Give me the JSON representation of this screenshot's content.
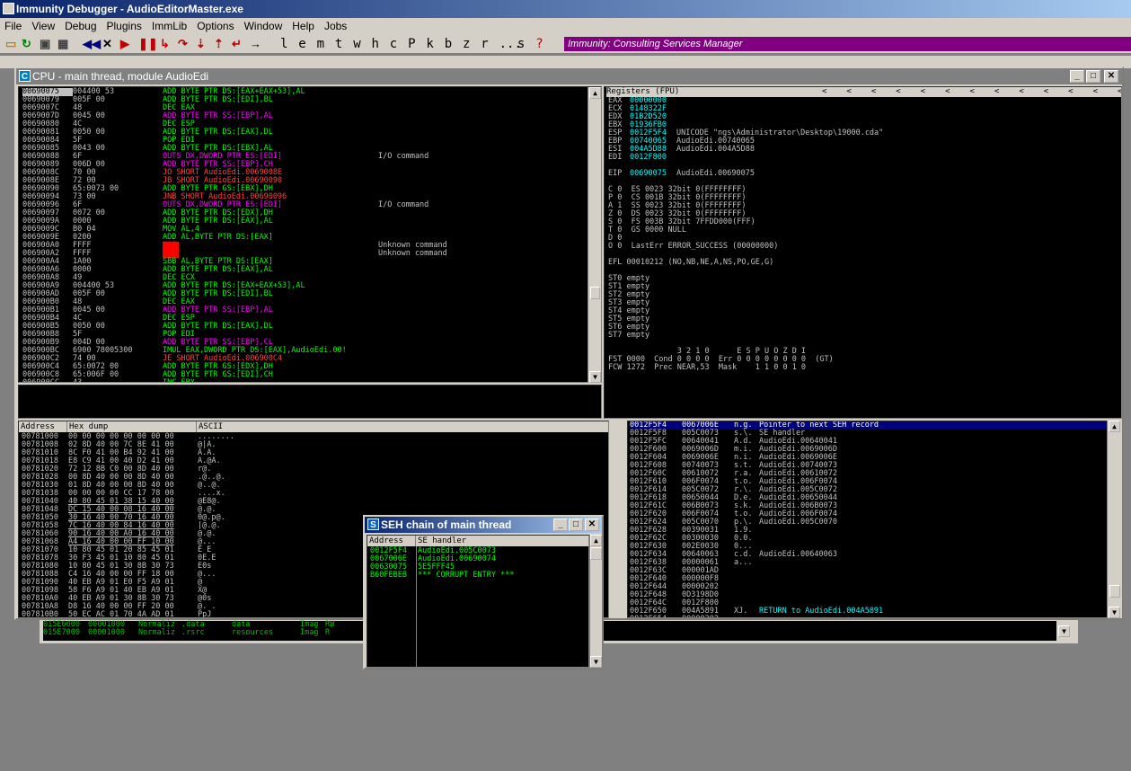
{
  "app": {
    "title": "Immunity Debugger - AudioEditorMaster.exe",
    "banner": "Immunity: Consulting Services Manager"
  },
  "menu": [
    "File",
    "View",
    "Debug",
    "Plugins",
    "ImmLib",
    "Options",
    "Window",
    "Help",
    "Jobs"
  ],
  "toolbar_letters": [
    "l",
    "e",
    "m",
    "t",
    "w",
    "h",
    "c",
    "P",
    "k",
    "b",
    "z",
    "r",
    "...",
    "s",
    "?"
  ],
  "cpu": {
    "title": "CPU - main thread, module AudioEdi",
    "disasm": [
      [
        "00690075",
        "004400 53",
        "ADD BYTE PTR DS:[EAX+EAX+53],AL",
        "",
        "sel"
      ],
      [
        "00690079",
        "005F 00",
        "ADD BYTE PTR DS:[EDI],BL",
        "",
        "c"
      ],
      [
        "0069007C",
        "48",
        "DEC EAX",
        "",
        "c"
      ],
      [
        "0069007D",
        "0045 00",
        "ADD BYTE PTR SS:[EBP],AL",
        "",
        "m"
      ],
      [
        "00690080",
        "4C",
        "DEC ESP",
        "",
        "c"
      ],
      [
        "00690081",
        "0050 00",
        "ADD BYTE PTR DS:[EAX],DL",
        "",
        "c"
      ],
      [
        "00690084",
        "5F",
        "POP EDI",
        "",
        "c"
      ],
      [
        "00690085",
        "0043 00",
        "ADD BYTE PTR DS:[EBX],AL",
        "",
        "c"
      ],
      [
        "00690088",
        "6F",
        "OUTS DX,DWORD PTR ES:[EDI]",
        "I/O command",
        "m"
      ],
      [
        "00690089",
        "006D 00",
        "ADD BYTE PTR SS:[EBP],CH",
        "",
        "m"
      ],
      [
        "0069008C",
        "70 00",
        "JO SHORT AudioEdi.0069008E",
        "",
        "j"
      ],
      [
        "0069008E",
        "72 00",
        "JB SHORT AudioEdi.00690090",
        "",
        "j"
      ],
      [
        "00690090",
        "65:0073 00",
        "ADD BYTE PTR GS:[EBX],DH",
        "",
        "c"
      ],
      [
        "00690094",
        "73 00",
        "JNB SHORT AudioEdi.00690096",
        "",
        "j"
      ],
      [
        "00690096",
        "6F",
        "OUTS DX,DWORD PTR ES:[EDI]",
        "I/O command",
        "m"
      ],
      [
        "00690097",
        "0072 00",
        "ADD BYTE PTR DS:[EDX],DH",
        "",
        "c"
      ],
      [
        "0069009A",
        "0000",
        "ADD BYTE PTR DS:[EAX],AL",
        "",
        "c"
      ],
      [
        "0069009C",
        "B0 04",
        "MOV AL,4",
        "",
        "c"
      ],
      [
        "0069009E",
        "0200",
        "ADD AL,BYTE PTR DS:[EAX]",
        "",
        "c"
      ],
      [
        "006900A0",
        "FFFF",
        "???",
        "Unknown command",
        "r"
      ],
      [
        "006900A2",
        "FFFF",
        "???",
        "Unknown command",
        "r"
      ],
      [
        "006900A4",
        "1A00",
        "SBB AL,BYTE PTR DS:[EAX]",
        "",
        "c"
      ],
      [
        "006900A6",
        "0000",
        "ADD BYTE PTR DS:[EAX],AL",
        "",
        "c"
      ],
      [
        "006900A8",
        "49",
        "DEC ECX",
        "",
        "c"
      ],
      [
        "006900A9",
        "004400 53",
        "ADD BYTE PTR DS:[EAX+EAX+53],AL",
        "",
        "c"
      ],
      [
        "006900AD",
        "005F 00",
        "ADD BYTE PTR DS:[EDI],BL",
        "",
        "c"
      ],
      [
        "006900B0",
        "48",
        "DEC EAX",
        "",
        "c"
      ],
      [
        "006900B1",
        "0045 00",
        "ADD BYTE PTR SS:[EBP],AL",
        "",
        "m"
      ],
      [
        "006900B4",
        "4C",
        "DEC ESP",
        "",
        "c"
      ],
      [
        "006900B5",
        "0050 00",
        "ADD BYTE PTR DS:[EAX],DL",
        "",
        "c"
      ],
      [
        "006900B8",
        "5F",
        "POP EDI",
        "",
        "c"
      ],
      [
        "006900B9",
        "004D 00",
        "ADD BYTE PTR SS:[EBP],CL",
        "",
        "m"
      ],
      [
        "006900BC",
        "6900 78005300",
        "IMUL EAX,DWORD PTR DS:[EAX],AudioEdi.00!",
        "",
        "c"
      ],
      [
        "006900C2",
        "74 00",
        "JE SHORT AudioEdi.006900C4",
        "",
        "j"
      ],
      [
        "006900C4",
        "65:0072 00",
        "ADD BYTE PTR GS:[EDX],DH",
        "",
        "c"
      ],
      [
        "006900C8",
        "65:006F 00",
        "ADD BYTE PTR GS:[EDI],CH",
        "",
        "c"
      ],
      [
        "006900CC",
        "43",
        "INC EBX",
        "",
        "c"
      ]
    ]
  },
  "registers": {
    "header": "Registers (FPU)",
    "lines": [
      [
        "EAX",
        "00000000",
        ""
      ],
      [
        "ECX",
        "0148322F",
        ""
      ],
      [
        "EDX",
        "01B2D520",
        ""
      ],
      [
        "EBX",
        "01936FB0",
        ""
      ],
      [
        "ESP",
        "0012F5F4",
        "UNICODE \"ngs\\Administrator\\Desktop\\19000.cda\""
      ],
      [
        "EBP",
        "00740065",
        "AudioEdi.00740065"
      ],
      [
        "ESI",
        "004A5D88",
        "AudioEdi.004A5D88"
      ],
      [
        "EDI",
        "0012F800",
        ""
      ],
      [
        "",
        "",
        " "
      ],
      [
        "EIP",
        "00690075",
        "AudioEdi.00690075"
      ]
    ],
    "flags": [
      "C 0  ES 0023 32bit 0(FFFFFFFF)",
      "P 0  CS 001B 32bit 0(FFFFFFFF)",
      "A 1  SS 0023 32bit 0(FFFFFFFF)",
      "Z 0  DS 0023 32bit 0(FFFFFFFF)",
      "S 0  FS 003B 32bit 7FFDD000(FFF)",
      "T 0  GS 0000 NULL",
      "D 0",
      "O 0  LastErr ERROR_SUCCESS (00000000)"
    ],
    "efl": "EFL 00010212 (NO,NB,NE,A,NS,PO,GE,G)",
    "st": [
      "ST0 empty",
      "ST1 empty",
      "ST2 empty",
      "ST3 empty",
      "ST4 empty",
      "ST5 empty",
      "ST6 empty",
      "ST7 empty"
    ],
    "fpu": [
      "               3 2 1 0      E S P U O Z D I",
      "FST 0000  Cond 0 0 0 0  Err 0 0 0 0 0 0 0 0  (GT)",
      "FCW 1272  Prec NEAR,53  Mask    1 1 0 0 1 0"
    ]
  },
  "dump": {
    "headers": [
      "Address",
      "Hex dump",
      "ASCII"
    ],
    "rows": [
      [
        "00781000",
        "00 00 00 00 00 00 00 00",
        "........"
      ],
      [
        "00781008",
        "02 8D 40 00 7C 8E 41 00",
        "@|A."
      ],
      [
        "00781010",
        "8C F0 41 00 B4 92 41 00",
        "A.A."
      ],
      [
        "00781018",
        "E8 C9 41 00 40 D2 41 00",
        "A.@A."
      ],
      [
        "00781020",
        "72 12 8B C0 00 8D 40 00",
        "r@."
      ],
      [
        "00781028",
        "00 8D 40 00 00 8D 40 00",
        ".@..@."
      ],
      [
        "00781030",
        "01 8D 40 00 00 8D 40 00",
        "@..@."
      ],
      [
        "00781038",
        "00 00 00 00 CC 17 78 00",
        "....x."
      ],
      [
        "00781040",
        "40 80 45 01 38 15 40 00",
        "@E8@."
      ],
      [
        "00781048",
        "DC 15 40 00 08 16 40 00",
        "@.@."
      ],
      [
        "00781050",
        "30 16 40 00 70 16 40 00",
        "0@.p@."
      ],
      [
        "00781058",
        "7C 16 40 00 84 16 40 00",
        "|@.@."
      ],
      [
        "00781060",
        "90 16 40 00 A0 16 40 00",
        "@.@."
      ],
      [
        "00781068",
        "A4 16 40 00 00 FF 10 00",
        "@..."
      ],
      [
        "00781070",
        "10 80 45 01 20 85 45 01",
        "E E"
      ],
      [
        "00781078",
        "30 F3 45 01 10 80 45 01",
        "0E.E"
      ],
      [
        "00781080",
        "10 80 45 01 30 8B 30 73",
        "E0s"
      ],
      [
        "00781088",
        "C4 16 40 00 00 FF 18 00",
        "@..."
      ],
      [
        "00781090",
        "40 EB A9 01 E0 F5 A9 01",
        "@"
      ],
      [
        "00781098",
        "58 F6 A9 01 40 EB A9 01",
        "X@"
      ],
      [
        "007810A0",
        "40 EB A9 01 30 8B 30 73",
        "@0s"
      ],
      [
        "007810A8",
        "D8 16 40 00 00 FF 20 00",
        "@. ."
      ],
      [
        "007810B0",
        "50 EC AC 01 70 4A AD 01",
        "PpJ"
      ]
    ]
  },
  "stack": [
    [
      "0012F5F4",
      "0067006E",
      "n.g.",
      "Pointer to next SEH record"
    ],
    [
      "0012F5F8",
      "005C0073",
      "s.\\.",
      "SE handler"
    ],
    [
      "0012F5FC",
      "00640041",
      "A.d.",
      "AudioEdi.00640041"
    ],
    [
      "0012F600",
      "0069006D",
      "m.i.",
      "AudioEdi.0069006D"
    ],
    [
      "0012F604",
      "0069006E",
      "n.i.",
      "AudioEdi.0069006E"
    ],
    [
      "0012F608",
      "00740073",
      "s.t.",
      "AudioEdi.00740073"
    ],
    [
      "0012F60C",
      "00610072",
      "r.a.",
      "AudioEdi.00610072"
    ],
    [
      "0012F610",
      "006F0074",
      "t.o.",
      "AudioEdi.006F0074"
    ],
    [
      "0012F614",
      "005C0072",
      "r.\\.",
      "AudioEdi.005C0072"
    ],
    [
      "0012F618",
      "00650044",
      "D.e.",
      "AudioEdi.00650044"
    ],
    [
      "0012F61C",
      "006B0073",
      "s.k.",
      "AudioEdi.006B0073"
    ],
    [
      "0012F620",
      "006F0074",
      "t.o.",
      "AudioEdi.006F0074"
    ],
    [
      "0012F624",
      "005C0070",
      "p.\\.",
      "AudioEdi.005C0070"
    ],
    [
      "0012F628",
      "00390031",
      "1.9.",
      ""
    ],
    [
      "0012F62C",
      "00300030",
      "0.0.",
      ""
    ],
    [
      "0012F630",
      "002E0030",
      "0...",
      ""
    ],
    [
      "0012F634",
      "00640063",
      "c.d.",
      "AudioEdi.00640063"
    ],
    [
      "0012F638",
      "00000061",
      "a...",
      ""
    ],
    [
      "0012F63C",
      "000001AD",
      "",
      ""
    ],
    [
      "0012F640",
      "000000F8",
      "",
      ""
    ],
    [
      "0012F644",
      "00000202",
      "",
      ""
    ],
    [
      "0012F648",
      "0D3198D0",
      "",
      ""
    ],
    [
      "0012F64C",
      "0012F800",
      "",
      ""
    ],
    [
      "0012F650",
      "004A5891",
      "XJ.",
      "RETURN to AudioEdi.004A5891"
    ],
    [
      "0012F654",
      "00000202",
      "",
      ""
    ]
  ],
  "memmap": [
    [
      "015E6000",
      "00001000",
      "Normaliz",
      ".data",
      "data",
      "Imag",
      "RW"
    ],
    [
      "015E7000",
      "00001000",
      "Normaliz",
      ".rsrc",
      "resources",
      "Imag",
      "R"
    ]
  ],
  "seh": {
    "title": "SEH chain of main thread",
    "headers": [
      "Address",
      "SE handler"
    ],
    "rows": [
      [
        "0012F5F4",
        "AudioEdi.005C0073"
      ],
      [
        "0067006E",
        "AudioEdi.00690074"
      ],
      [
        "00630075",
        "5E5FFF45"
      ],
      [
        "B60FEBEB",
        "*** CORRUPT ENTRY ***"
      ]
    ]
  }
}
